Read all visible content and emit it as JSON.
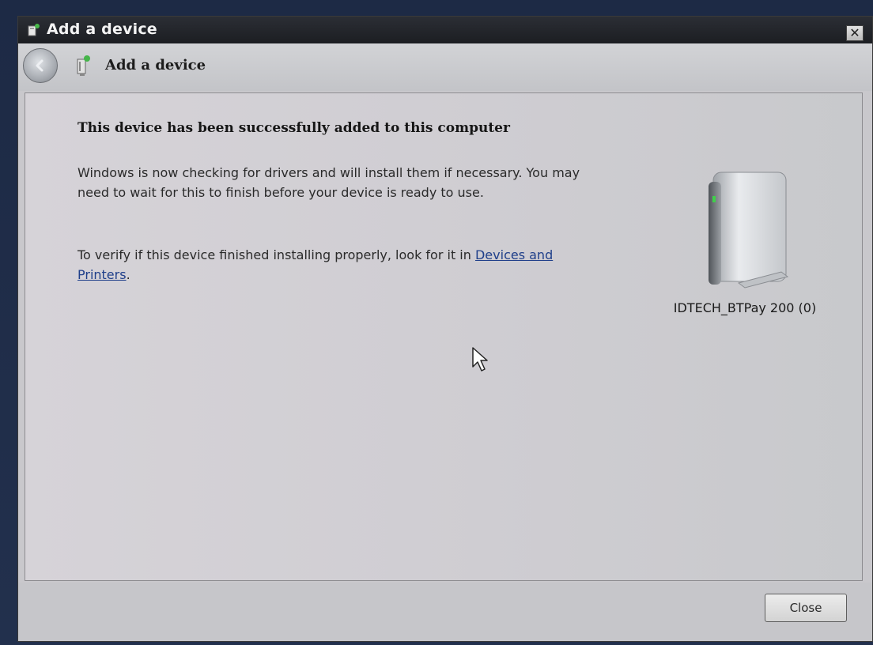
{
  "window": {
    "title": "Add a device",
    "close_glyph": "✕"
  },
  "navbar": {
    "title": "Add a device"
  },
  "content": {
    "heading": "This device has been successfully added to this computer",
    "para1": "Windows is now checking for drivers and will install them if necessary. You may need to wait for this to finish before your device is ready to use.",
    "para2_prefix": "To verify if this device finished installing properly, look for it in ",
    "para2_link": "Devices and Printers",
    "para2_suffix": "."
  },
  "device": {
    "name": "IDTECH_BTPay 200 (0)",
    "icon": "external-drive-icon"
  },
  "footer": {
    "close_label": "Close"
  },
  "colors": {
    "titlebar": "#1c1e22",
    "link": "#1f3f8a",
    "background": "#c9c8cc"
  }
}
